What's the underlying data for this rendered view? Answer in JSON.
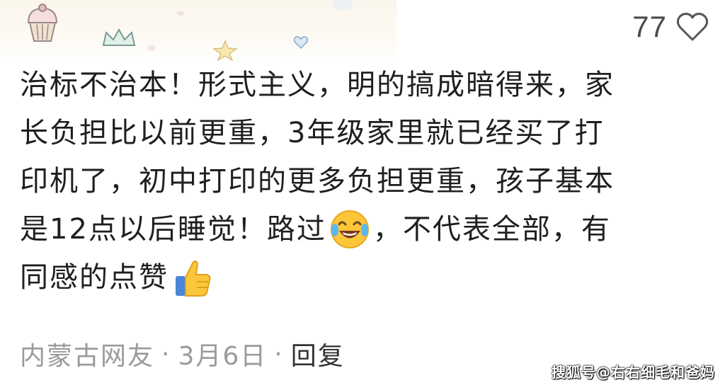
{
  "like": {
    "count": "77",
    "icon": "heart-outline-icon"
  },
  "comment": {
    "lines": [
      "治标不治本！形式主义，明的搞成暗得来，家",
      "长负担比以前更重，3年级家里就已经买了打",
      "印机了，初中打印的更多负担更重，孩子基本",
      "是12点以后睡觉！路过",
      "，不代表全部，有",
      "同感的点赞"
    ],
    "emojis": [
      "laughing-crying-emoji",
      "thumbs-up-emoji"
    ]
  },
  "meta": {
    "location": "内蒙古网友",
    "dot1": "·",
    "date": "3月6日",
    "dot2": "·",
    "reply": "回复"
  },
  "watermark": "搜狐号@右右细毛和爸妈",
  "colors": {
    "text": "#1f1f1f",
    "meta": "#9a9a9a",
    "like": "#4a4a4a",
    "banner": "#fbf6ec"
  }
}
